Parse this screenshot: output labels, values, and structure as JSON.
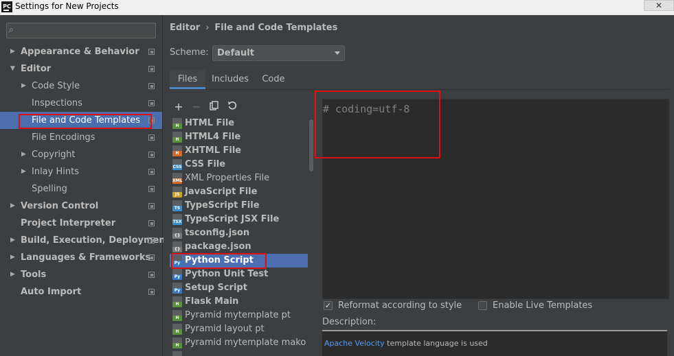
{
  "window": {
    "title": "Settings for New Projects",
    "app_icon_text": "PC",
    "close_label": "✕"
  },
  "search": {
    "icon": "search-icon",
    "value": ""
  },
  "tree": [
    {
      "label": "Appearance & Behavior",
      "expanded": false,
      "bold": true
    },
    {
      "label": "Editor",
      "expanded": true,
      "bold": true
    },
    {
      "label": "Code Style",
      "expanded": false
    },
    {
      "label": "Inspections"
    },
    {
      "label": "File and Code Templates",
      "selected": true
    },
    {
      "label": "File Encodings"
    },
    {
      "label": "Copyright",
      "expanded": false
    },
    {
      "label": "Inlay Hints",
      "expanded": false
    },
    {
      "label": "Spelling"
    },
    {
      "label": "Version Control",
      "expanded": false,
      "bold": true
    },
    {
      "label": "Project Interpreter",
      "bold": true
    },
    {
      "label": "Build, Execution, Deployment",
      "expanded": false,
      "bold": true
    },
    {
      "label": "Languages & Frameworks",
      "expanded": false,
      "bold": true
    },
    {
      "label": "Tools",
      "expanded": false,
      "bold": true
    },
    {
      "label": "Auto Import",
      "bold": true
    }
  ],
  "breadcrumb": {
    "parent": "Editor",
    "separator": "›",
    "current": "File and Code Templates"
  },
  "scheme": {
    "label": "Scheme:",
    "value": "Default"
  },
  "tabs": [
    {
      "label": "Files",
      "active": true
    },
    {
      "label": "Includes"
    },
    {
      "label": "Code"
    }
  ],
  "toolbar": {
    "add": "+",
    "remove": "−",
    "copy_icon": "copy-icon",
    "reset_icon": "reset-icon"
  },
  "templates": [
    {
      "name": "HTML File",
      "icon": "H",
      "color": "#5a8f3c",
      "bold": true
    },
    {
      "name": "HTML4 File",
      "icon": "H",
      "color": "#5a8f3c",
      "bold": true
    },
    {
      "name": "XHTML File",
      "icon": "H",
      "color": "#d36a2b",
      "bold": true
    },
    {
      "name": "CSS File",
      "icon": "CSS",
      "color": "#3d8bc9",
      "bold": true
    },
    {
      "name": "XML Properties File",
      "icon": "XML",
      "color": "#d36a2b",
      "bold": false
    },
    {
      "name": "JavaScript File",
      "icon": "JS",
      "color": "#c9a227",
      "bold": true
    },
    {
      "name": "TypeScript File",
      "icon": "TS",
      "color": "#3d8bc9",
      "bold": true
    },
    {
      "name": "TypeScript JSX File",
      "icon": "TSX",
      "color": "#3d8bc9",
      "bold": true
    },
    {
      "name": "tsconfig.json",
      "icon": "{}",
      "color": "#7a7a7a",
      "bold": true
    },
    {
      "name": "package.json",
      "icon": "{}",
      "color": "#7a7a7a",
      "bold": true
    },
    {
      "name": "Python Script",
      "icon": "Py",
      "color": "#3b78c2",
      "bold": true,
      "selected": true
    },
    {
      "name": "Python Unit Test",
      "icon": "Py",
      "color": "#3b78c2",
      "bold": true
    },
    {
      "name": "Setup Script",
      "icon": "Py",
      "color": "#3b78c2",
      "bold": true
    },
    {
      "name": "Flask Main",
      "icon": "H",
      "color": "#5a8f3c",
      "bold": true
    },
    {
      "name": "Pyramid mytemplate pt",
      "icon": "H",
      "color": "#5a8f3c",
      "bold": false
    },
    {
      "name": "Pyramid layout pt",
      "icon": "H",
      "color": "#5a8f3c",
      "bold": false
    },
    {
      "name": "Pyramid mytemplate mako",
      "icon": "H",
      "color": "#5a8f3c",
      "bold": false
    },
    {
      "name": "",
      "icon": "H",
      "color": "#5a8f3c",
      "bold": false
    }
  ],
  "editor": {
    "content": "# coding=utf-8"
  },
  "options": {
    "reformat_label": "Reformat according to style",
    "reformat_checked": true,
    "live_label": "Enable Live Templates",
    "live_checked": false
  },
  "description": {
    "label": "Description:",
    "link": "Apache Velocity",
    "text": " template language is used"
  },
  "colors": {
    "selection": "#4b6eaf",
    "highlight_box": "#e01010",
    "link": "#589df6"
  }
}
